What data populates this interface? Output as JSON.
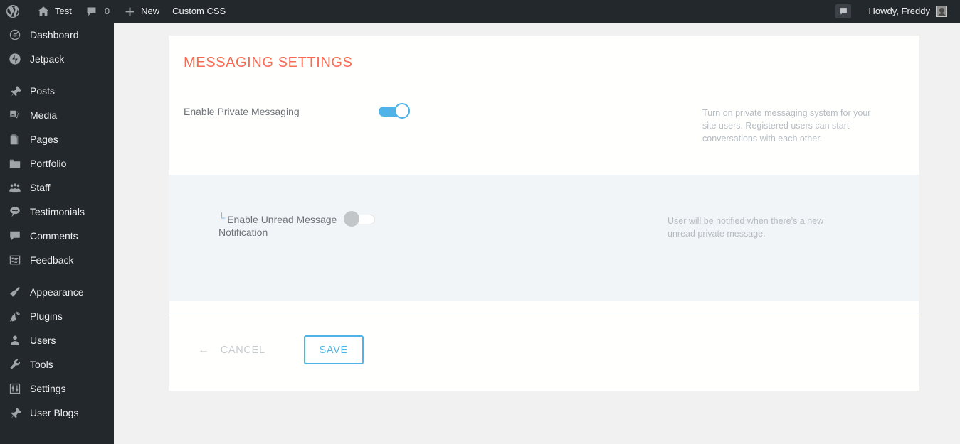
{
  "admin_bar": {
    "wp_logo_icon": "wordpress-logo-icon",
    "site": {
      "icon": "home-icon",
      "label": "Test"
    },
    "comments": {
      "icon": "comment-bubble-icon",
      "count": "0"
    },
    "new": {
      "icon": "plus-icon",
      "label": "New"
    },
    "custom_css": {
      "label": "Custom CSS"
    },
    "right": {
      "notifications_icon": "comment-bubble-icon",
      "howdy": "Howdy, Freddy",
      "avatar": "user-avatar"
    }
  },
  "sidebar": {
    "items": [
      {
        "label": "Dashboard",
        "icon": "dashboard-icon",
        "sep_after": false
      },
      {
        "label": "Jetpack",
        "icon": "jetpack-icon",
        "sep_after": true
      },
      {
        "label": "Posts",
        "icon": "pin-icon",
        "sep_after": false
      },
      {
        "label": "Media",
        "icon": "media-icon",
        "sep_after": false
      },
      {
        "label": "Pages",
        "icon": "pages-icon",
        "sep_after": false
      },
      {
        "label": "Portfolio",
        "icon": "portfolio-icon",
        "sep_after": false
      },
      {
        "label": "Staff",
        "icon": "staff-icon",
        "sep_after": false
      },
      {
        "label": "Testimonials",
        "icon": "testimonials-icon",
        "sep_after": false
      },
      {
        "label": "Comments",
        "icon": "comments-icon",
        "sep_after": false
      },
      {
        "label": "Feedback",
        "icon": "feedback-icon",
        "sep_after": true
      },
      {
        "label": "Appearance",
        "icon": "appearance-brush-icon",
        "sep_after": false
      },
      {
        "label": "Plugins",
        "icon": "plugins-plug-icon",
        "sep_after": false
      },
      {
        "label": "Users",
        "icon": "users-icon",
        "sep_after": false
      },
      {
        "label": "Tools",
        "icon": "tools-wrench-icon",
        "sep_after": false
      },
      {
        "label": "Settings",
        "icon": "settings-sliders-icon",
        "sep_after": false
      },
      {
        "label": "User Blogs",
        "icon": "pin-icon",
        "sep_after": false
      }
    ]
  },
  "panel": {
    "title": "MESSAGING SETTINGS",
    "title_color": "#f96a53",
    "accent_color": "#4fb3e8",
    "rows": [
      {
        "label": "Enable Private Messaging",
        "child_mark": "",
        "toggle_state": "on",
        "description": "Turn on private messaging system for your site users. Registered users can start conversations with each other."
      },
      {
        "label": "Enable Unread Message Notification",
        "child_mark": "└",
        "toggle_state": "off",
        "description": "User will be notified when there's a new unread private message."
      }
    ],
    "footer": {
      "cancel_arrow": "←",
      "cancel_label": "CANCEL",
      "save_label": "SAVE"
    }
  }
}
